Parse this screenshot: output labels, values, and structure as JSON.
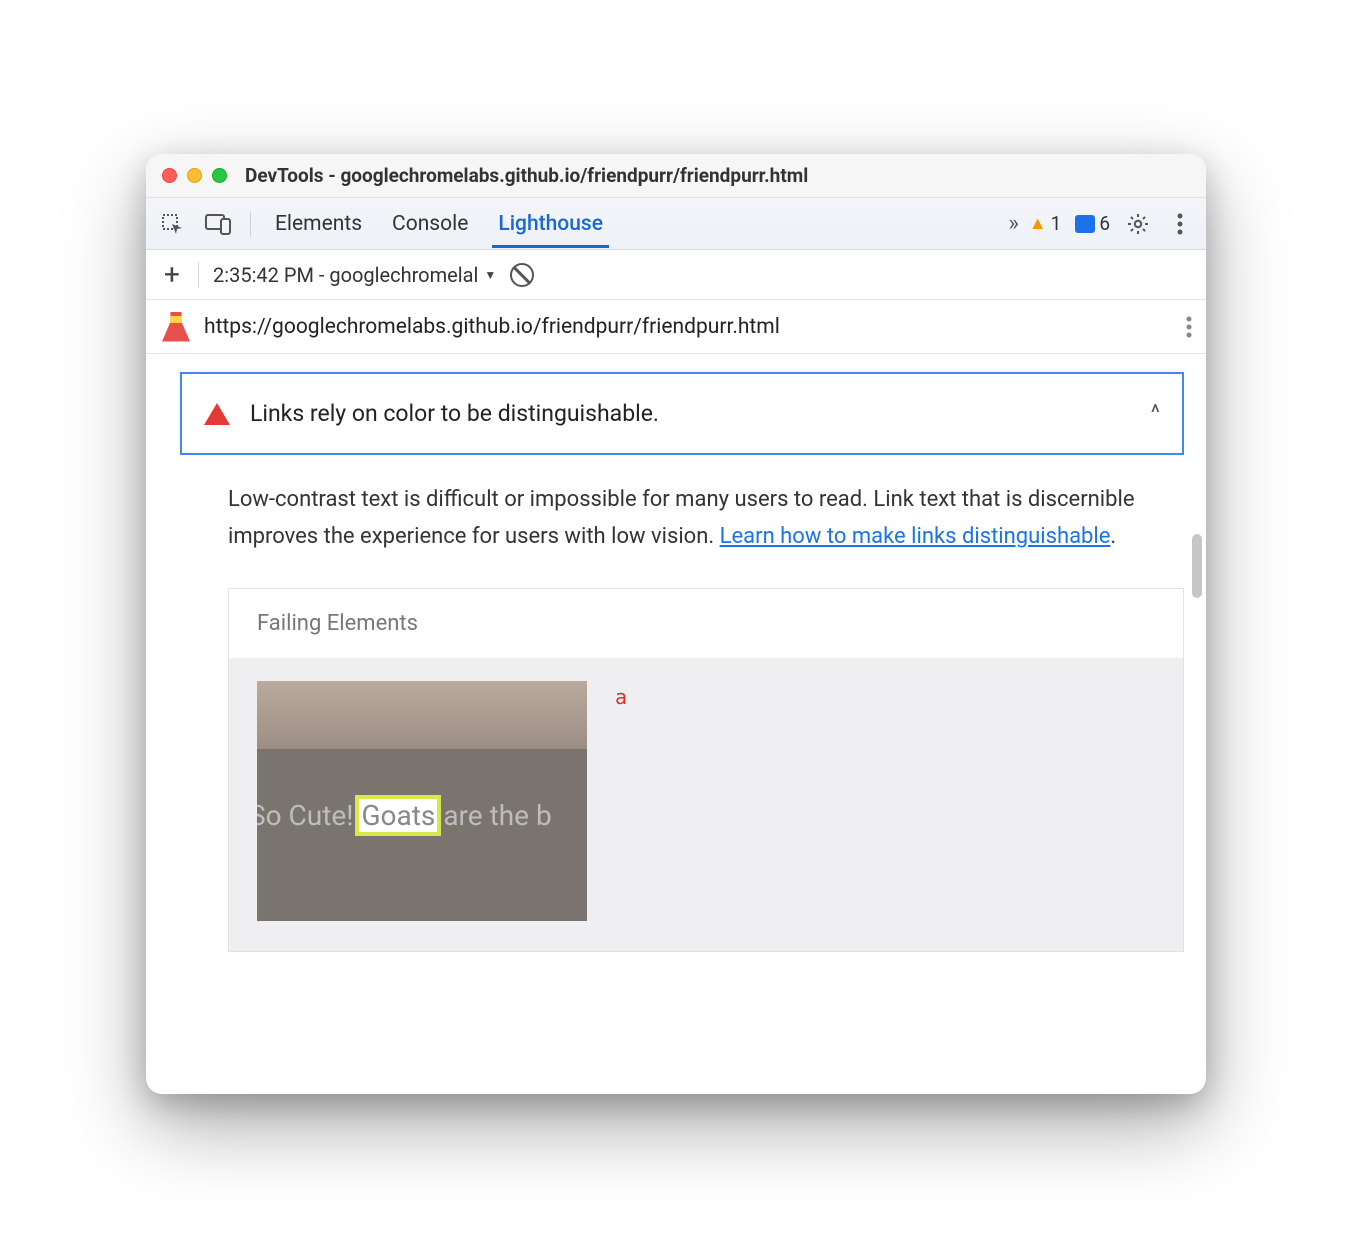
{
  "titlebar": {
    "title": "DevTools - googlechromelabs.github.io/friendpurr/friendpurr.html"
  },
  "tabs": {
    "elements": "Elements",
    "console": "Console",
    "lighthouse": "Lighthouse"
  },
  "badges": {
    "warnings": "1",
    "messages": "6"
  },
  "subbar": {
    "report_label": "2:35:42 PM - googlechromelal"
  },
  "urlrow": {
    "url": "https://googlechromelabs.github.io/friendpurr/friendpurr.html"
  },
  "audit": {
    "title": "Links rely on color to be distinguishable.",
    "description_pre": "Low-contrast text is difficult or impossible for many users to read. Link text that is discernible improves the experience for users with low vision. ",
    "learn_link": "Learn how to make links distinguishable",
    "description_post": "."
  },
  "panel": {
    "heading": "Failing Elements",
    "element_tag": "a",
    "thumb_text_pre": "So Cute! ",
    "thumb_text_hl": "Goats",
    "thumb_text_post": " are the b"
  }
}
